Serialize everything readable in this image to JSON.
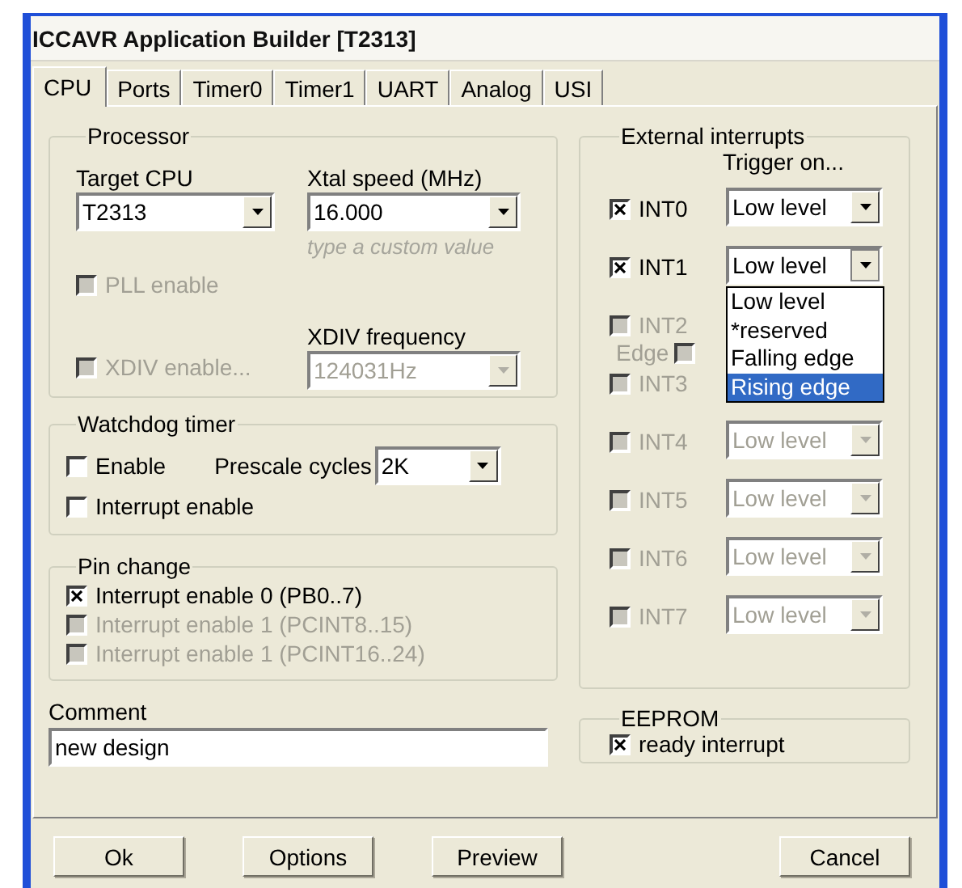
{
  "window": {
    "title": "ICCAVR Application Builder [T2313]"
  },
  "tabs": [
    {
      "label": "CPU",
      "selected": true
    },
    {
      "label": "Ports",
      "selected": false
    },
    {
      "label": "Timer0",
      "selected": false
    },
    {
      "label": "Timer1",
      "selected": false
    },
    {
      "label": "UART",
      "selected": false
    },
    {
      "label": "Analog",
      "selected": false
    },
    {
      "label": "USI",
      "selected": false
    }
  ],
  "processor": {
    "title": "Processor",
    "target_cpu": {
      "label": "Target CPU",
      "value": "T2313"
    },
    "xtal_speed": {
      "label": "Xtal speed (MHz)",
      "value": "16.000",
      "hint": "type a custom value"
    },
    "pll_enable": {
      "label": "PLL enable",
      "checked": false,
      "disabled": true
    },
    "xdiv_enable": {
      "label": "XDIV enable...",
      "checked": false,
      "disabled": true
    },
    "xdiv_frequency": {
      "label": "XDIV frequency",
      "value": "124031Hz",
      "disabled": true
    }
  },
  "watchdog": {
    "title": "Watchdog timer",
    "enable": {
      "label": "Enable",
      "checked": false,
      "disabled": false
    },
    "prescale": {
      "label": "Prescale cycles",
      "value": "2K"
    },
    "interrupt_enable": {
      "label": "Interrupt enable",
      "checked": false,
      "disabled": false
    }
  },
  "pin_change": {
    "title": "Pin change",
    "items": [
      {
        "label": "Interrupt enable 0 (PB0..7)",
        "checked": true,
        "disabled": false
      },
      {
        "label": "Interrupt enable 1 (PCINT8..15)",
        "checked": false,
        "disabled": true
      },
      {
        "label": "Interrupt enable 1 (PCINT16..24)",
        "checked": false,
        "disabled": true
      }
    ]
  },
  "comment": {
    "label": "Comment",
    "value": "new design"
  },
  "external_interrupts": {
    "title": "External interrupts",
    "trigger_heading": "Trigger on...",
    "items": [
      {
        "name": "INT0",
        "checked": true,
        "disabled": false,
        "trigger": "Low level",
        "open": false
      },
      {
        "name": "INT1",
        "checked": true,
        "disabled": false,
        "trigger": "Low level",
        "open": true
      },
      {
        "name": "INT2",
        "checked": false,
        "disabled": true,
        "edge": {
          "label": "Edge",
          "checked": false
        }
      },
      {
        "name": "INT3",
        "checked": false,
        "disabled": true
      },
      {
        "name": "INT4",
        "checked": false,
        "disabled": true,
        "trigger": "Low level",
        "open": false
      },
      {
        "name": "INT5",
        "checked": false,
        "disabled": true,
        "trigger": "Low level",
        "open": false
      },
      {
        "name": "INT6",
        "checked": false,
        "disabled": true,
        "trigger": "Low level",
        "open": false
      },
      {
        "name": "INT7",
        "checked": false,
        "disabled": true,
        "trigger": "Low level",
        "open": false
      }
    ],
    "dropdown_options": [
      {
        "label": "Low level",
        "selected": false
      },
      {
        "label": "*reserved",
        "selected": false
      },
      {
        "label": "Falling edge",
        "selected": false
      },
      {
        "label": "Rising edge",
        "selected": true
      }
    ]
  },
  "eeprom": {
    "title": "EEPROM",
    "ready_interrupt": {
      "label": "ready interrupt",
      "checked": true,
      "disabled": false
    }
  },
  "buttons": [
    "Ok",
    "Options",
    "Preview",
    "Cancel"
  ]
}
